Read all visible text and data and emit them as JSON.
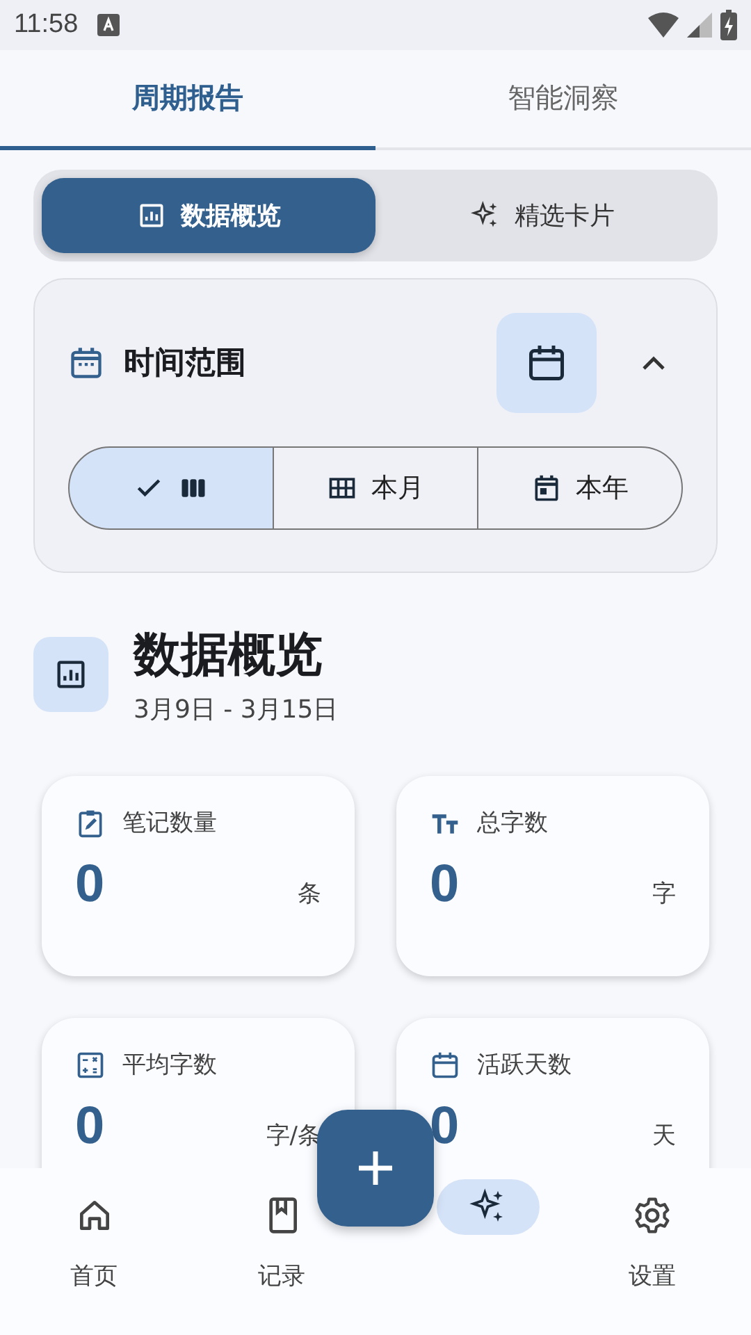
{
  "status_bar": {
    "time": "11:58"
  },
  "tabs": [
    {
      "label": "周期报告",
      "selected": true
    },
    {
      "label": "智能洞察",
      "selected": false
    }
  ],
  "view_toggle": [
    {
      "label": "数据概览",
      "selected": true
    },
    {
      "label": "精选卡片",
      "selected": false
    }
  ],
  "time_range": {
    "title": "时间范围",
    "expanded": true,
    "segments": [
      {
        "selected": true
      },
      {
        "label": "本月",
        "selected": false
      },
      {
        "label": "本年",
        "selected": false
      }
    ]
  },
  "overview": {
    "title": "数据概览",
    "date_range": "3月9日 - 3月15日"
  },
  "stats": [
    {
      "label": "笔记数量",
      "value": "0",
      "unit": "条"
    },
    {
      "label": "总字数",
      "value": "0",
      "unit": "字"
    },
    {
      "label": "平均字数",
      "value": "0",
      "unit": "字/条"
    },
    {
      "label": "活跃天数",
      "value": "0",
      "unit": "天"
    }
  ],
  "nav": [
    {
      "label": "首页",
      "selected": false
    },
    {
      "label": "记录",
      "selected": false
    },
    {
      "selected": true
    },
    {
      "label": "设置",
      "selected": false
    }
  ]
}
